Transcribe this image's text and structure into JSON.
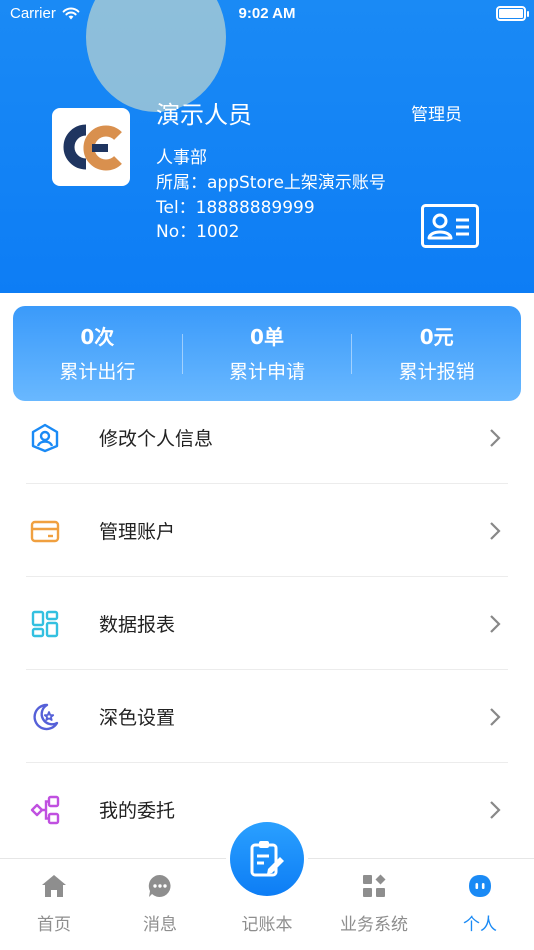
{
  "status_bar": {
    "carrier": "Carrier",
    "time": "9:02 AM"
  },
  "profile": {
    "name": "演示人员",
    "role": "管理员",
    "department": "人事部",
    "affiliation": "所属：appStore上架演示账号",
    "tel": "Tel：18888889999",
    "no": "No：1002",
    "logo_icon": "company-logo-gc",
    "card_icon": "id-card-icon"
  },
  "stats": [
    {
      "value": "0次",
      "label": "累计出行"
    },
    {
      "value": "0单",
      "label": "累计申请"
    },
    {
      "value": "0元",
      "label": "累计报销"
    }
  ],
  "menu": [
    {
      "label": "修改个人信息",
      "icon": "user-profile-icon",
      "color": "#1a8af5"
    },
    {
      "label": "管理账户",
      "icon": "wallet-card-icon",
      "color": "#f0a040"
    },
    {
      "label": "数据报表",
      "icon": "data-report-icon",
      "color": "#33c0e0"
    },
    {
      "label": "深色设置",
      "icon": "moon-star-icon",
      "color": "#5560d8"
    },
    {
      "label": "我的委托",
      "icon": "share-node-icon",
      "color": "#c050e0"
    }
  ],
  "tabs": [
    {
      "label": "首页",
      "icon": "home-icon"
    },
    {
      "label": "消息",
      "icon": "message-icon"
    },
    {
      "label": "记账本",
      "icon": "notebook-edit-icon"
    },
    {
      "label": "业务系统",
      "icon": "apps-grid-icon"
    },
    {
      "label": "个人",
      "icon": "person-icon"
    }
  ],
  "colors": {
    "primary": "#1a8af5",
    "tab_inactive": "#8e8e8e"
  }
}
